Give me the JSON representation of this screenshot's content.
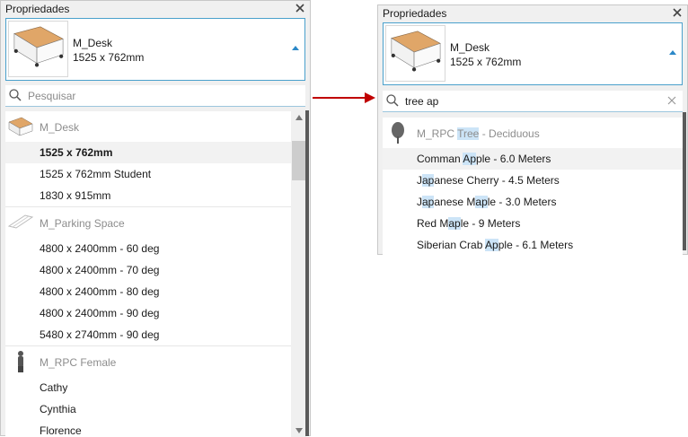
{
  "left_panel": {
    "title": "Propriedades",
    "type_name": "M_Desk",
    "type_size": "1525 x 762mm",
    "search_placeholder": "Pesquisar",
    "groups": [
      {
        "name": "M_Desk",
        "icon": "desk-icon",
        "items": [
          "1525 x 762mm",
          "1525 x 762mm Student",
          "1830 x 915mm"
        ],
        "selected": "1525 x 762mm"
      },
      {
        "name": "M_Parking Space",
        "icon": "parking-space-icon",
        "items": [
          "4800 x 2400mm - 60 deg",
          "4800 x 2400mm - 70 deg",
          "4800 x 2400mm - 80 deg",
          "4800 x 2400mm - 90 deg",
          "5480 x 2740mm - 90 deg"
        ]
      },
      {
        "name": "M_RPC Female",
        "icon": "person-icon",
        "items": [
          "Cathy",
          "Cynthia",
          "Florence"
        ]
      }
    ]
  },
  "right_panel": {
    "title": "Propriedades",
    "type_name": "M_Desk",
    "type_size": "1525 x 762mm",
    "search_value": "tree ap",
    "group": {
      "name_parts": [
        {
          "t": "M_RPC ",
          "h": false
        },
        {
          "t": "Tree",
          "h": true
        },
        {
          "t": " - Deciduous",
          "h": false
        }
      ],
      "icon": "tree-icon"
    },
    "items": [
      [
        {
          "t": "Comman ",
          "h": false
        },
        {
          "t": "Ap",
          "h": true
        },
        {
          "t": "ple - 6.0 Meters",
          "h": false
        }
      ],
      [
        {
          "t": "J",
          "h": false
        },
        {
          "t": "ap",
          "h": true
        },
        {
          "t": "anese Cherry - 4.5 Meters",
          "h": false
        }
      ],
      [
        {
          "t": "J",
          "h": false
        },
        {
          "t": "ap",
          "h": true
        },
        {
          "t": "anese M",
          "h": false
        },
        {
          "t": "ap",
          "h": true
        },
        {
          "t": "le - 3.0 Meters",
          "h": false
        }
      ],
      [
        {
          "t": "Red M",
          "h": false
        },
        {
          "t": "ap",
          "h": true
        },
        {
          "t": "le - 9 Meters",
          "h": false
        }
      ],
      [
        {
          "t": "Siberian Crab ",
          "h": false
        },
        {
          "t": "Ap",
          "h": true
        },
        {
          "t": "ple - 6.1 Meters",
          "h": false
        }
      ]
    ]
  },
  "colors": {
    "accent_border": "#4aa0cc",
    "highlight": "#cce4f7",
    "arrow": "#c00000"
  }
}
